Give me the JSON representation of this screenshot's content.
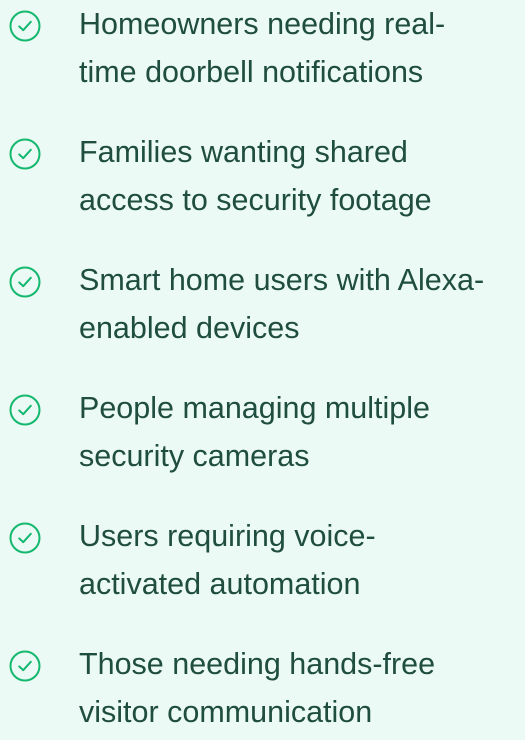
{
  "checklist": {
    "icon_name": "check-circle-icon",
    "accent_color": "#14b86f",
    "text_color": "#1f4d3f",
    "background_color": "#ebfaf4",
    "items": [
      {
        "line1": "Homeowners needing real-",
        "line2": "time doorbell notifications"
      },
      {
        "line1": "Families wanting shared",
        "line2": "access to security footage"
      },
      {
        "line1": "Smart home users with Alexa-",
        "line2": "enabled devices"
      },
      {
        "line1": "People managing multiple",
        "line2": "security cameras"
      },
      {
        "line1": "Users requiring voice-",
        "line2": "activated automation"
      },
      {
        "line1": "Those needing hands-free",
        "line2": "visitor communication"
      }
    ]
  }
}
